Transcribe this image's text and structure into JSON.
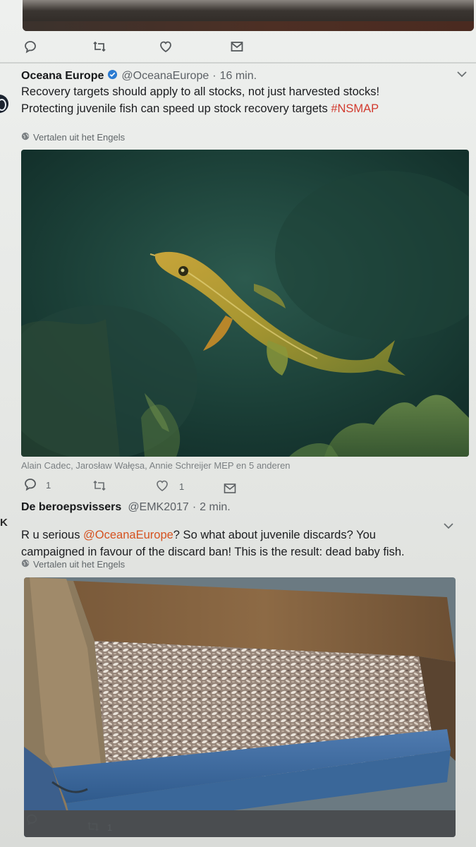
{
  "tweet1": {
    "name": "Oceana Europe",
    "handle": "@OceanaEurope",
    "separator": "·",
    "time": "16 min.",
    "text_line1": "Recovery targets should apply to all stocks, not just harvested stocks!",
    "text_line2": "Protecting juvenile fish can speed up stock recovery targets ",
    "hashtag": "#NSMAP",
    "translate": "Vertalen uit het Engels",
    "likers_caption": "Alain Cadec, Jarosław Wałęsa, Annie Schreijer MEP en 5 anderen",
    "reply_count": "1",
    "like_count": "1",
    "image_icon": "cod-fish-underwater-photo"
  },
  "tweet2": {
    "name": "De beroepsvissers",
    "handle": "@EMK2017",
    "separator": "·",
    "time": "2 min.",
    "text_a": "R u serious ",
    "mention": "@OceanaEurope",
    "text_b": "? So what about juvenile discards? You",
    "text_line2": "campaigned in favour of the discard ban! This is the result: dead baby fish.",
    "translate": "Vertalen uit het Engels",
    "retweet_count": "1",
    "avatar_letter": "K",
    "image_icon": "crate-of-dead-juvenile-fish-photo"
  },
  "colors": {
    "hashtag": "#d23b2f",
    "mention": "#d5521f",
    "verified": "#2b7bd1"
  }
}
